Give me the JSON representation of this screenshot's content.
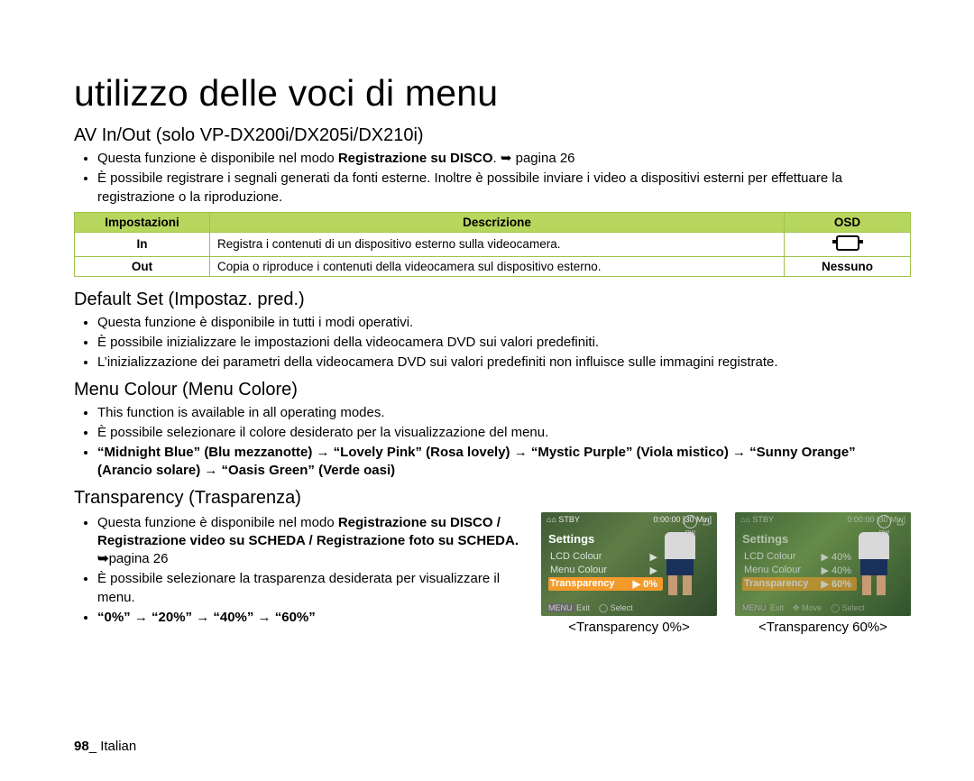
{
  "page_title": "utilizzo delle voci di menu",
  "av": {
    "heading": "AV In/Out (solo VP-DX200i/DX205i/DX210i)",
    "b1a": "Questa funzione è disponibile nel modo ",
    "b1b": "Registrazione su DISCO",
    "b1c": ". ➥ pagina 26",
    "b2": "È possibile registrare i segnali generati da fonti esterne. Inoltre è possibile inviare i video a dispositivi esterni per effettuare la registrazione o la riproduzione.",
    "th1": "Impostazioni",
    "th2": "Descrizione",
    "th3": "OSD",
    "r1c1": "In",
    "r1c2": "Registra i contenuti di un dispositivo esterno sulla videocamera.",
    "r2c1": "Out",
    "r2c2": "Copia o riproduce i contenuti della videocamera sul dispositivo esterno.",
    "r2c3": "Nessuno"
  },
  "def": {
    "heading": "Default Set (Impostaz. pred.)",
    "b1": "Questa funzione è disponibile in tutti i modi operativi.",
    "b2": "È possibile inizializzare le impostazioni della videocamera DVD sui valori predefiniti.",
    "b3": "L’inizializzazione dei parametri della videocamera DVD sui valori predefiniti non influisce sulle immagini registrate."
  },
  "menu": {
    "heading": "Menu Colour (Menu Colore)",
    "b1": "This function is available in all operating modes.",
    "b2": "È possibile selezionare il colore desiderato per la visualizzazione del menu.",
    "b3": "“Midnight Blue” (Blu mezzanotte) → “Lovely Pink” (Rosa lovely) → “Mystic Purple” (Viola mistico) → “Sunny Orange” (Arancio solare) → “Oasis Green” (Verde oasi)"
  },
  "trans": {
    "heading": "Transparency (Trasparenza)",
    "b1a": "Questa funzione è disponibile nel modo ",
    "b1b": "Registrazione su DISCO / Registrazione video su SCHEDA / Registrazione foto su SCHEDA. ➥",
    "b1c": "pagina 26",
    "b2": "È possibile selezionare la trasparenza desiderata per visualizzare il menu.",
    "b3": "“0%” → “20%” → “40%” → “60%”"
  },
  "thumb": {
    "top_stby": "STBY",
    "top_time": "0:00:00 [30 Min]",
    "title": "Settings",
    "row1": "LCD Colour",
    "row2": "Menu Colour",
    "row3": "Transparency",
    "val0": "0%",
    "val40": "40%",
    "val60": "60%",
    "bottom_exit": "Exit",
    "bottom_select": "Select",
    "bottom_move": "Move",
    "menu_chip": "MENU",
    "disc": "-RW",
    "label0": "<Transparency 0%>",
    "label60": "<Transparency 60%>"
  },
  "footer": {
    "page": "98",
    "sep": "_ ",
    "lang": "Italian"
  }
}
